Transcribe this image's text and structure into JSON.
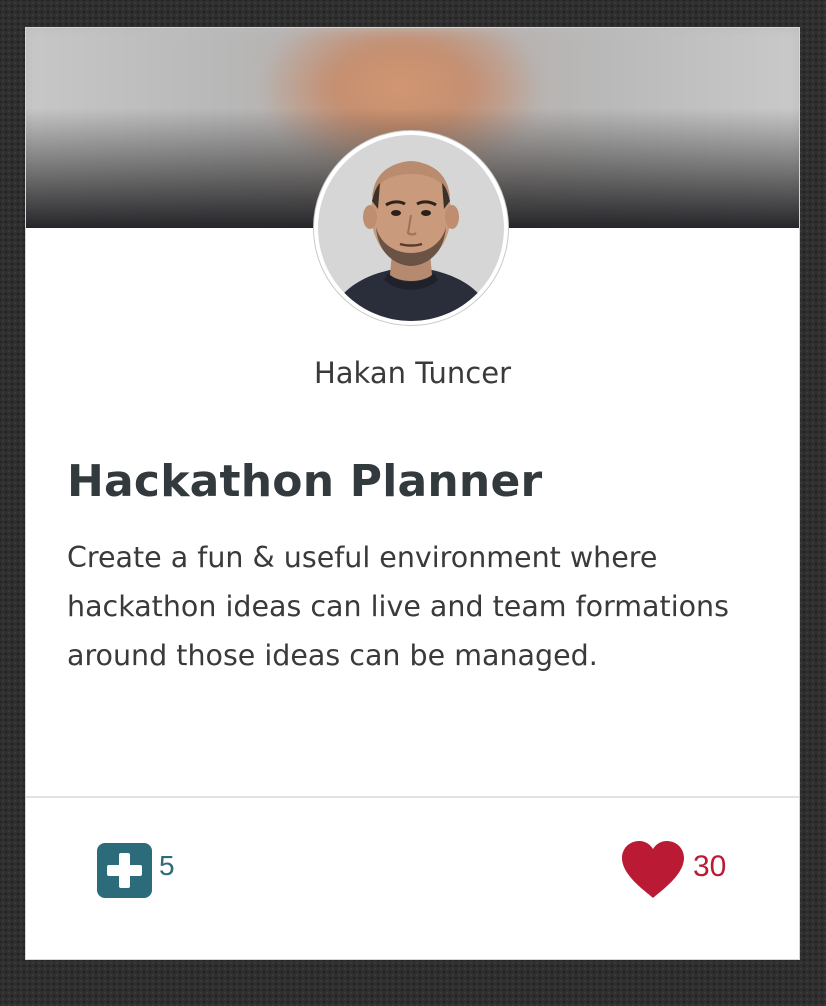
{
  "card": {
    "author_name": "Hakan Tuncer",
    "title": "Hackathon Planner",
    "description": "Create a fun & useful environment where hackathon ideas can live and team formations around those ideas can be managed."
  },
  "actions": {
    "join": {
      "icon": "plus-square-icon",
      "count": "5",
      "color": "#2b6b7a"
    },
    "like": {
      "icon": "heart-icon",
      "count": "30",
      "color": "#bb1a35"
    }
  }
}
